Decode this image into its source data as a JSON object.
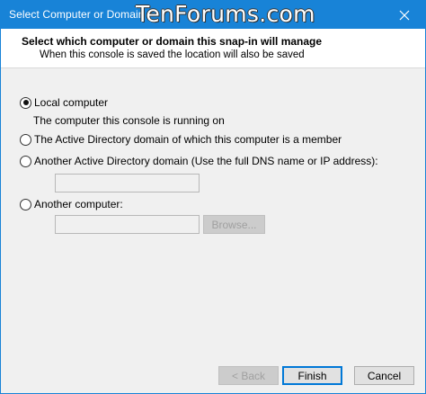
{
  "window": {
    "title": "Select Computer or Domain",
    "watermark": "TenForums.com"
  },
  "header": {
    "title": "Select which computer or domain this snap-in will manage",
    "subtitle": "When this console is saved the location will also be saved"
  },
  "options": {
    "local": {
      "label": "Local computer",
      "description": "The computer this console is running on",
      "checked": true
    },
    "ad_domain": {
      "label": "The Active Directory domain of which this computer is a member",
      "checked": false
    },
    "another_domain": {
      "label": "Another Active Directory domain (Use the full DNS name or IP address):",
      "value": "",
      "checked": false
    },
    "another_computer": {
      "label": "Another computer:",
      "value": "",
      "checked": false
    }
  },
  "buttons": {
    "browse": "Browse...",
    "back": "< Back",
    "finish": "Finish",
    "cancel": "Cancel"
  },
  "colors": {
    "title_bar": "#1883d7",
    "accent": "#0078d7"
  },
  "icons": {
    "close": "close-icon"
  }
}
